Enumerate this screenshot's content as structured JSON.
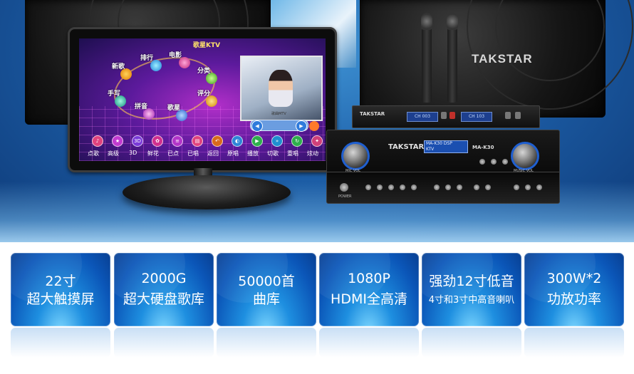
{
  "hero": {
    "brand_logo": "TAKSTAR",
    "monitor": {
      "title": "歌星KTV",
      "menu_items": [
        "新歌",
        "排行",
        "电影",
        "分类",
        "评分",
        "歌星",
        "拼音",
        "手写"
      ],
      "bottom_labels": [
        "点歌",
        "高级",
        "3D",
        "鲜花",
        "已点",
        "已唱",
        "返回",
        "原唱",
        "播放",
        "切歌",
        "重唱",
        "炫动"
      ],
      "video_caption": "歌曲MTV"
    },
    "receiver": {
      "logo": "TAKSTAR",
      "display_a": "CH 003",
      "display_b": "CH 103"
    },
    "amplifier": {
      "logo": "TAKSTAR",
      "model": "MA-K30",
      "display_line1": "MA-K30 DSP",
      "display_line2": "KTV",
      "mic_vol_label": "MIC VOL",
      "music_vol_label": "MUSIC VOL",
      "power_label": "POWER"
    }
  },
  "features": [
    {
      "line1": "22寸",
      "line2": "超大触摸屏"
    },
    {
      "line1": "2000G",
      "line2": "超大硬盘歌库"
    },
    {
      "line1": "50000首",
      "line2": "曲库"
    },
    {
      "line1": "1080P",
      "line2": "HDMI全高清"
    },
    {
      "line1": "强劲12寸低音",
      "line2": "4寸和3寸中高音喇叭"
    },
    {
      "line1": "300W*2",
      "line2": "功放功率"
    }
  ],
  "colors": {
    "hero_blue": "#1d5fa8",
    "card_blue": "#0b56b8",
    "card_text": "#ffffff",
    "knob_ring": "#1f5fd0",
    "screen_purple": "#5c1a9c"
  }
}
